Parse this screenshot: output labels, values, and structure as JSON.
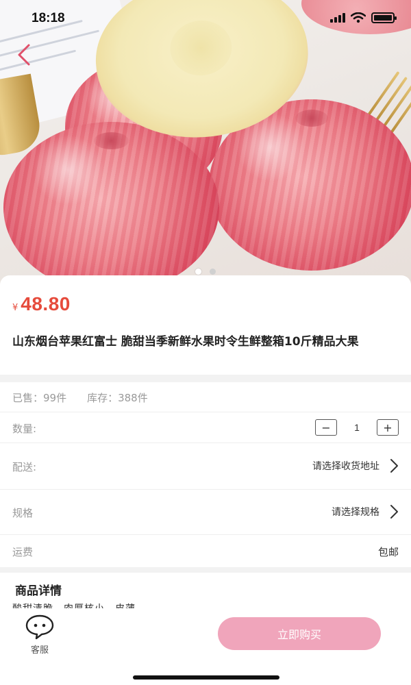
{
  "status_bar": {
    "time": "18:18"
  },
  "product": {
    "currency": "¥",
    "price": "48.80",
    "title": "山东烟台苹果红富士 脆甜当季新鲜水果时令生鲜整箱10斤精品大果",
    "sold": "已售：99件",
    "stock": "库存：388件",
    "carousel": {
      "count": 2,
      "active": 0
    }
  },
  "quantity": {
    "label": "数量:",
    "value": "1",
    "minus": "−",
    "plus": "+"
  },
  "delivery": {
    "label": "配送:",
    "value": "请选择收货地址"
  },
  "spec": {
    "label": "规格",
    "value": "请选择规格"
  },
  "shipping": {
    "label": "运费",
    "value": "包邮"
  },
  "details": {
    "title": "商品详情",
    "text": "酸甜清脆　肉厚核小　皮薄"
  },
  "bottom_bar": {
    "service_label": "客服",
    "buy_label": "立即购买"
  },
  "colors": {
    "price": "#e64b3c",
    "buy_button": "#f0a5bb",
    "back_arrow": "#e0506a"
  },
  "icons": [
    "back-arrow-icon",
    "signal-icon",
    "wifi-icon",
    "battery-icon",
    "chevron-right-icon",
    "customer-service-icon"
  ]
}
